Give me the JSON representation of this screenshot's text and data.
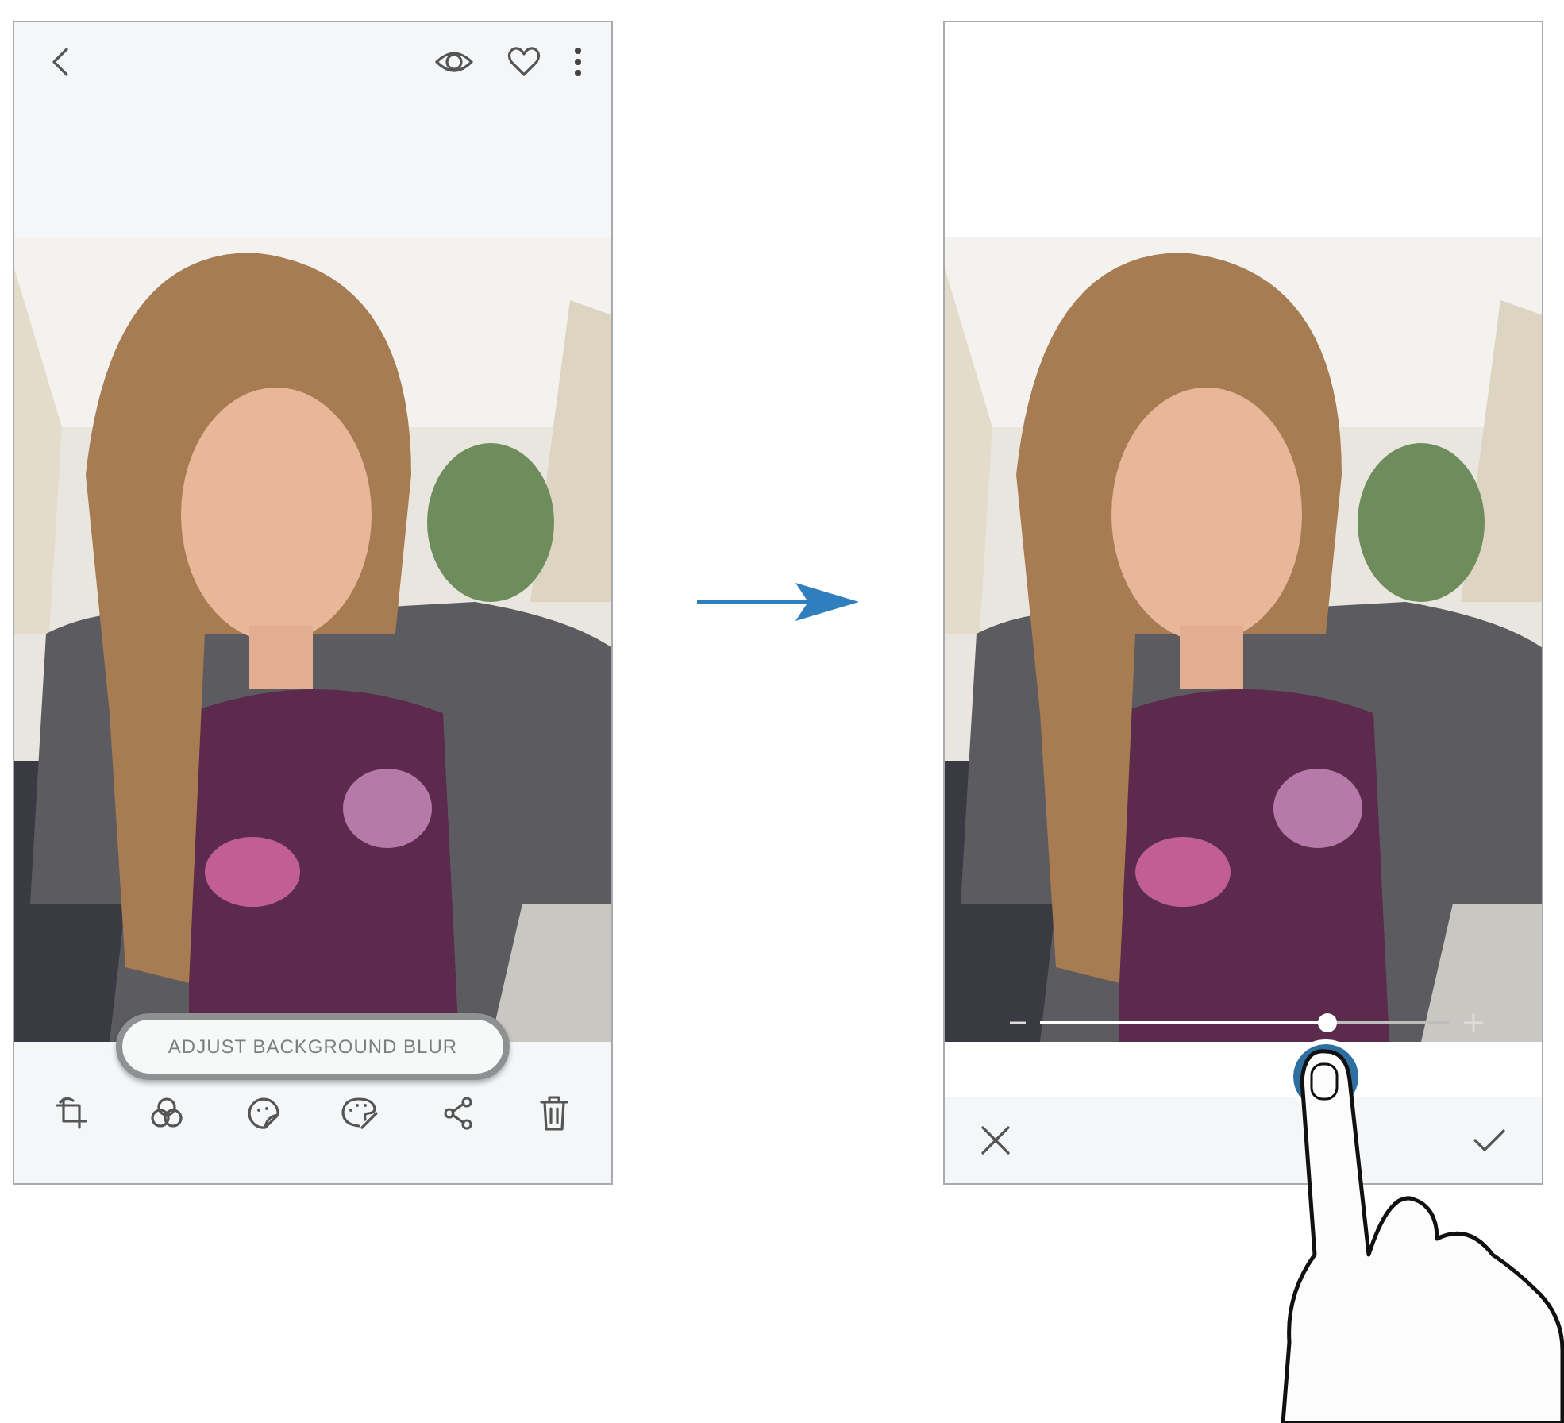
{
  "before_screen": {
    "tooltip": "ADJUST BACKGROUND BLUR"
  },
  "after_screen": {
    "blur_slider": {
      "level": 0.7
    }
  }
}
